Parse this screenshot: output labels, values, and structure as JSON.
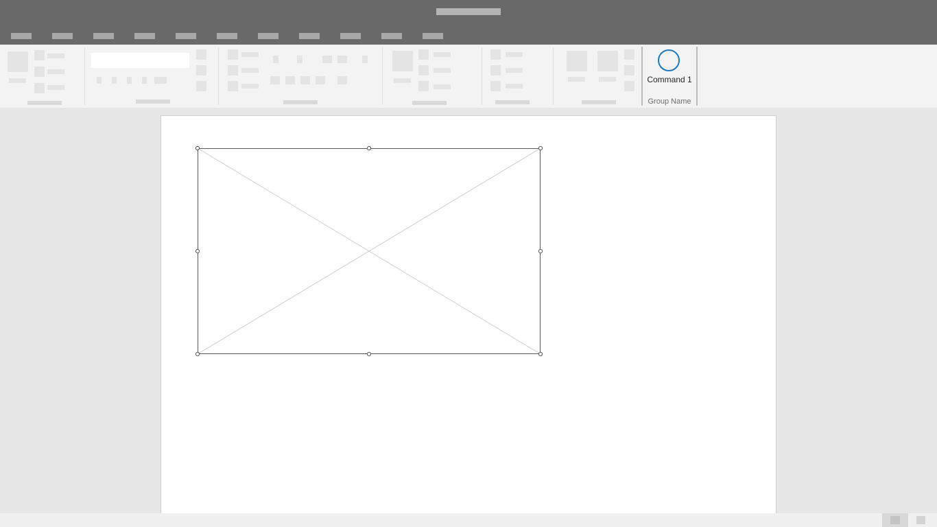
{
  "ribbon": {
    "command": {
      "label": "Command 1",
      "icon": "circle-icon",
      "accent": "#1e79c3"
    },
    "group_name": "Group Name"
  },
  "colors": {
    "titlebar": "#696969",
    "ribbon": "#f3f3f3",
    "canvas": "#e6e6e6",
    "page": "#ffffff"
  }
}
